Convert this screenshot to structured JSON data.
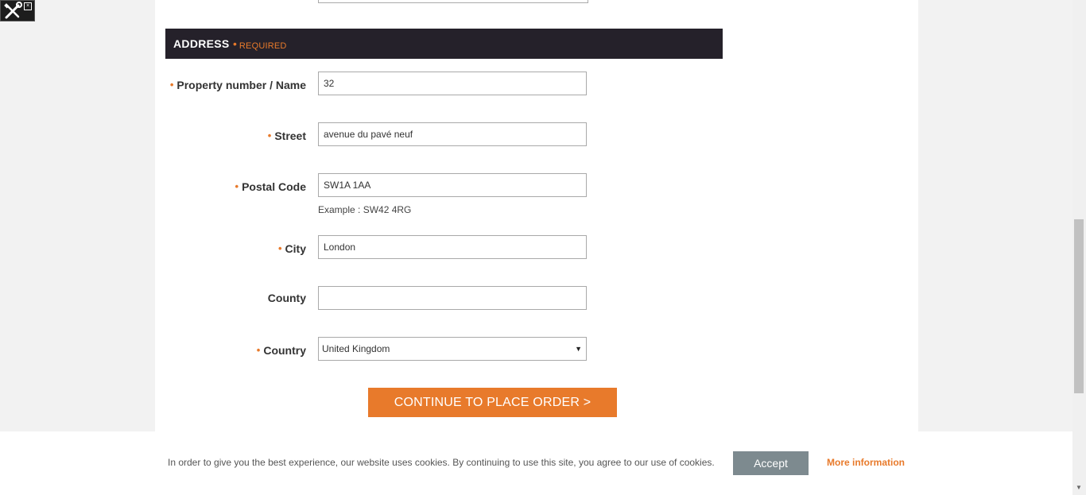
{
  "section": {
    "title": "ADDRESS",
    "required_label": "REQUIRED"
  },
  "fields": {
    "property": {
      "label": "Property number / Name",
      "value": "32",
      "required": true
    },
    "street": {
      "label": "Street",
      "value": "avenue du pavé neuf",
      "required": true
    },
    "postal": {
      "label": "Postal Code",
      "value": "SW1A 1AA",
      "hint": "Example : SW42 4RG",
      "required": true
    },
    "city": {
      "label": "City",
      "value": "London",
      "required": true
    },
    "county": {
      "label": "County",
      "value": "",
      "required": false
    },
    "country": {
      "label": "Country",
      "value": "United Kingdom",
      "required": true
    }
  },
  "submit_label": "CONTINUE TO PLACE ORDER >",
  "cookie": {
    "text": "In order to give you the best experience, our website uses cookies. By continuing to use this site, you agree to our use of cookies.",
    "accept_label": "Accept",
    "more_label": "More information"
  },
  "colors": {
    "accent": "#e87a2b",
    "header_bg": "#25212a",
    "accept_bg": "#7d8a8f"
  },
  "icons": {
    "toolbox": "tools-icon",
    "required_marker": "bullet-dot"
  }
}
